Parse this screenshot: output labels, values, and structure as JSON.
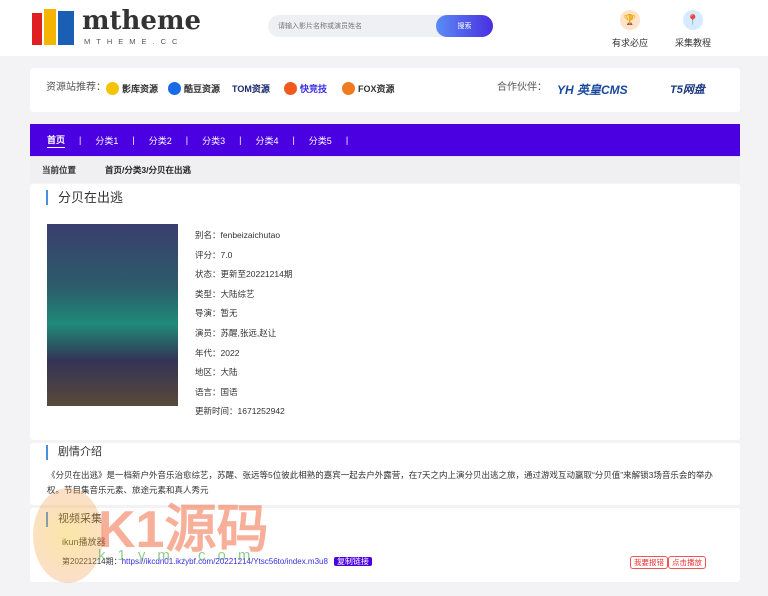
{
  "header": {
    "logo": "mtheme",
    "logo_sub": "MTHEME.CC",
    "search_placeholder": "请输入影片名称或演员姓名",
    "search_button": "搜索",
    "links": [
      {
        "label": "有求必应",
        "icon": "trophy-icon"
      },
      {
        "label": "采集教程",
        "icon": "location-icon"
      }
    ]
  },
  "recommend": {
    "label": "资源站推荐：",
    "sites": [
      "影库资源",
      "酷豆资源",
      "TOM资源",
      "快竞技",
      "FOX资源"
    ],
    "partner_label": "合作伙伴：",
    "partners": [
      "YH 英皇CMS",
      "T5网盘"
    ]
  },
  "nav": {
    "items": [
      "首页",
      "分类1",
      "分类2",
      "分类3",
      "分类4",
      "分类5"
    ],
    "active": "首页"
  },
  "breadcrumb": {
    "label": "当前位置",
    "path": "首页/分类3/分贝在出逃"
  },
  "title": "分贝在出逃",
  "info": [
    {
      "k": "别名：",
      "v": "fenbeizaichutao"
    },
    {
      "k": "评分：",
      "v": "7.0"
    },
    {
      "k": "状态：",
      "v": "更新至20221214期"
    },
    {
      "k": "类型：",
      "v": "大陆综艺"
    },
    {
      "k": "导演：",
      "v": "暂无"
    },
    {
      "k": "演员：",
      "v": "苏醒,张远,赵让"
    },
    {
      "k": "年代：",
      "v": "2022"
    },
    {
      "k": "地区：",
      "v": "大陆"
    },
    {
      "k": "语言：",
      "v": "国语"
    },
    {
      "k": "更新时间：",
      "v": "1671252942"
    }
  ],
  "plot": {
    "title": "剧情介绍",
    "text": "《分贝在出逃》是一档新户外音乐治愈综艺，苏醒、张远等5位彼此相熟的嘉宾一起去户外露营，在7天之内上演分贝出逃之旅，通过游戏互动赢取“分贝值”来解锁3场音乐会的举办权。节目集音乐元素、旅途元素和真人秀元"
  },
  "video": {
    "title": "视频采集",
    "player": "ikun播放器",
    "episode": "第20221214期：",
    "url": "https://ikcdn01.ikzybf.com/20221214/Ytsc56to/index.m3u8",
    "copy": "复制链接",
    "report": "我要报错",
    "play": "点击播放"
  },
  "watermark": {
    "text": "K1源码",
    "sub": "k1ym.com"
  }
}
